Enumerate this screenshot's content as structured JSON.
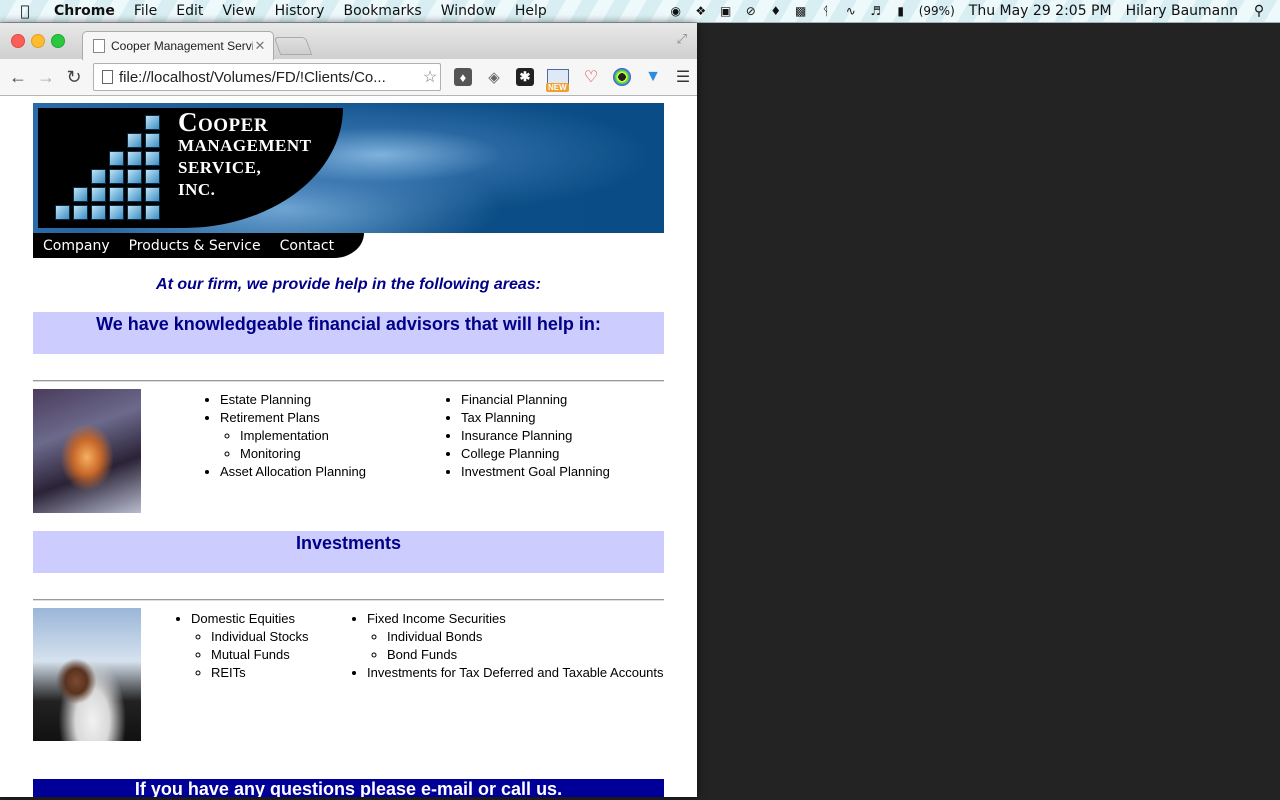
{
  "menubar": {
    "app_name": "Chrome",
    "menus": [
      "File",
      "Edit",
      "View",
      "History",
      "Bookmarks",
      "Window",
      "Help"
    ],
    "battery_pct": "(99%)",
    "datetime": "Thu May 29  2:05 PM",
    "user": "Hilary Baumann"
  },
  "browser": {
    "tab_title": "Cooper Management Servic",
    "url": "file://localhost/Volumes/FD/!Clients/Co...",
    "ext_new_badge": "NEW"
  },
  "site": {
    "brand": {
      "line1": "Cooper",
      "line2": "Management",
      "line3": "Service,",
      "line4": "Inc."
    },
    "nav": [
      "Company",
      "Products & Service",
      "Contact"
    ],
    "intro": "At our firm, we provide help in the following areas:",
    "advisors_heading": "We have knowledgeable financial advisors that will help in:",
    "planning_col1": {
      "estate": "Estate Planning",
      "retirement": "Retirement Plans",
      "implementation": "Implementation",
      "monitoring": "Monitoring",
      "asset": "Asset Allocation Planning"
    },
    "planning_col2": [
      "Financial Planning",
      "Tax Planning",
      "Insurance Planning",
      "College Planning",
      "Investment Goal Planning"
    ],
    "investments_heading": "Investments",
    "inv_col1": {
      "domestic": "Domestic Equities",
      "individual_stocks": "Individual Stocks",
      "mutual_funds": "Mutual Funds",
      "reits": "REITs"
    },
    "inv_col2": {
      "fixed": "Fixed Income Securities",
      "individual_bonds": "Individual Bonds",
      "bond_funds": "Bond Funds",
      "tax_deferred": "Investments for Tax Deferred and Taxable Accounts"
    },
    "contact_band": "If you have any questions please e-mail or call us."
  }
}
